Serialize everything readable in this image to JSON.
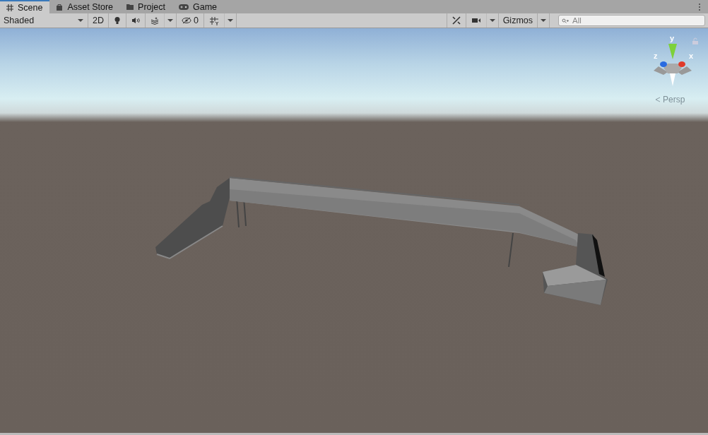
{
  "tabs": [
    {
      "label": "Scene",
      "selected": true
    },
    {
      "label": "Asset Store",
      "selected": false
    },
    {
      "label": "Project",
      "selected": false
    },
    {
      "label": "Game",
      "selected": false
    }
  ],
  "toolbar": {
    "shading_mode": "Shaded",
    "mode_2d": {
      "label": "2D",
      "selected": false
    },
    "hidden_count": "0",
    "gizmos": "Gizmos",
    "search": {
      "placeholder": "All"
    }
  },
  "orientation_gizmo": {
    "axes": [
      {
        "label": "y"
      },
      {
        "label": "z"
      },
      {
        "label": "x"
      }
    ],
    "projection": "Persp"
  }
}
